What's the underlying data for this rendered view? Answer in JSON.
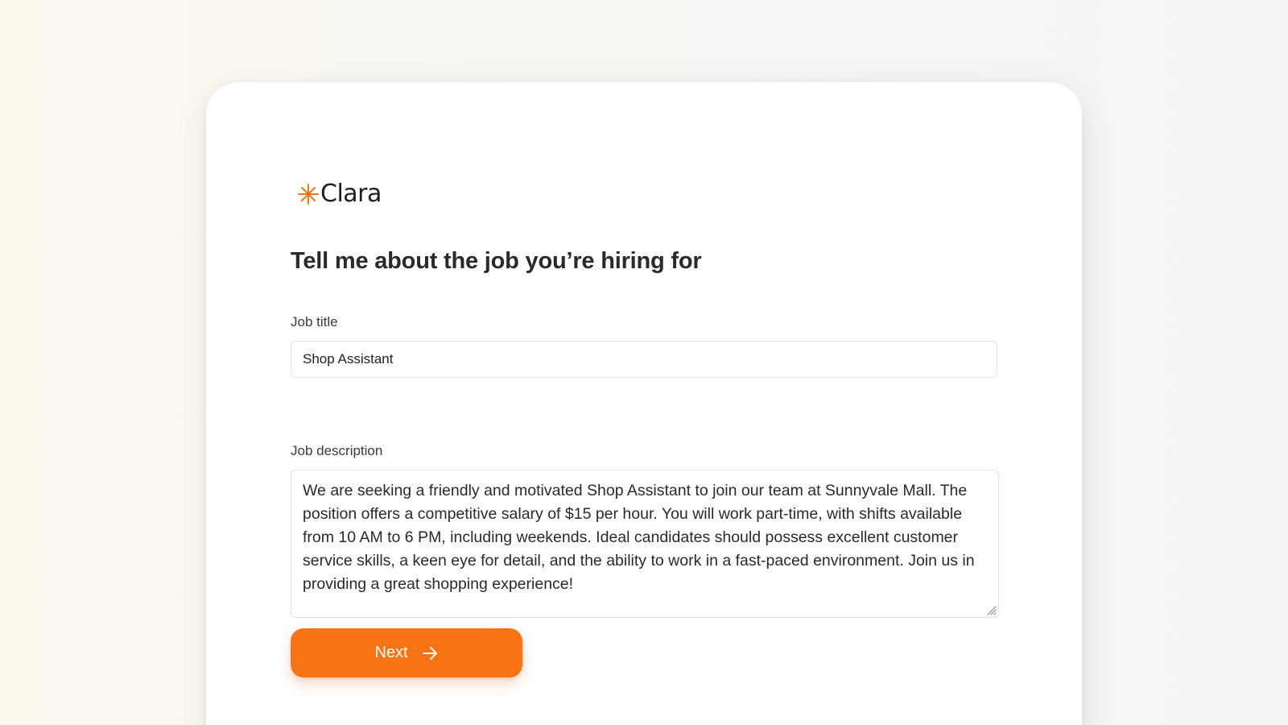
{
  "brand": {
    "name": "Clara",
    "logo_icon": "sparkle-star-icon",
    "accent_color": "#f97316"
  },
  "form": {
    "heading": "Tell me about the job you’re hiring for",
    "job_title": {
      "label": "Job title",
      "value": "Shop Assistant"
    },
    "job_description": {
      "label": "Job description",
      "value": "We are seeking a friendly and motivated Shop Assistant to join our team at Sunnyvale Mall. The position offers a competitive salary of $15 per hour. You will work part-time, with shifts available from 10 AM to 6 PM, including weekends. Ideal candidates should possess excellent customer service skills, a keen eye for detail, and the ability to work in a fast-paced environment. Join us in providing a great shopping experience!"
    },
    "next_button": {
      "label": "Next",
      "icon": "arrow-right-icon"
    }
  }
}
